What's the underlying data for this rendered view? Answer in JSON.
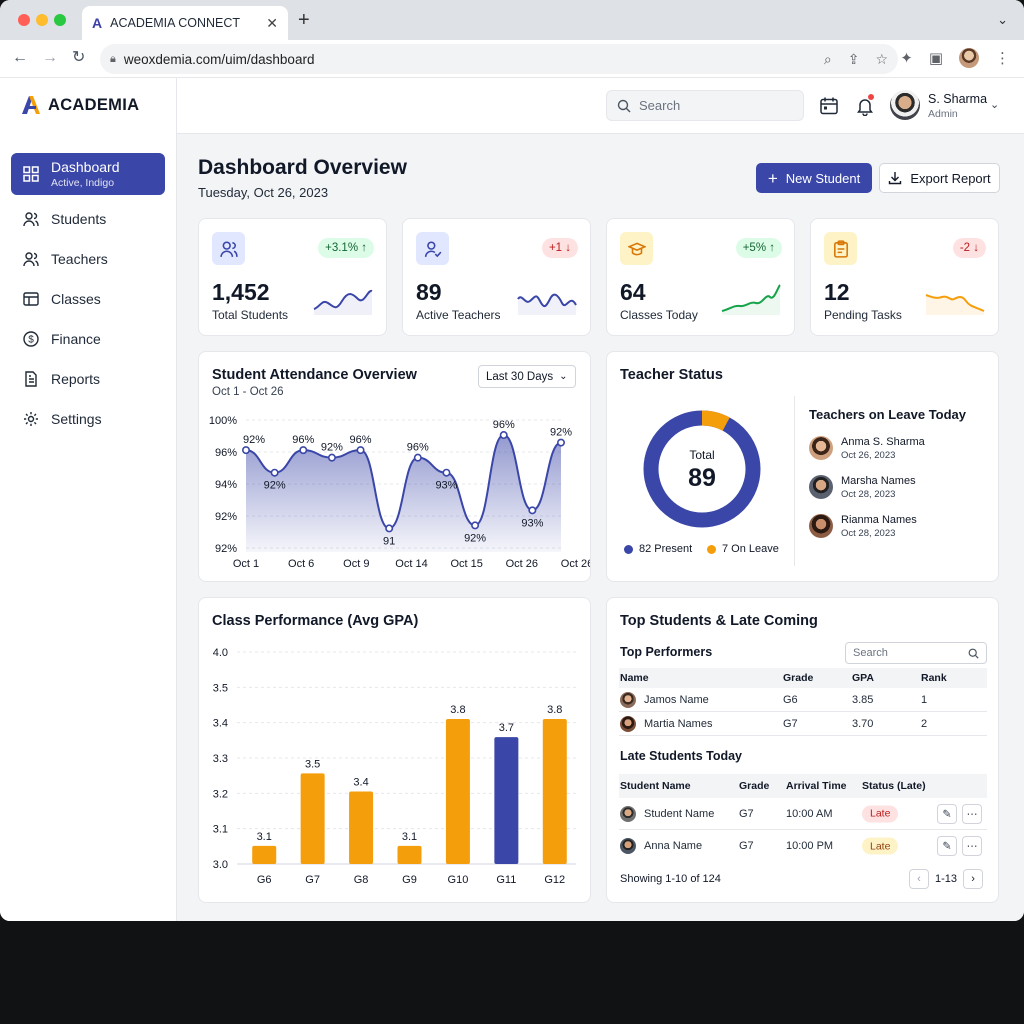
{
  "browser": {
    "tab_title": "ACADEMIA CONNECT",
    "tab_favicon": "A",
    "url": "weoxdemia.com/uim/dashboard",
    "new_tab_symbol": "+",
    "close_symbol": "✕"
  },
  "sidebar": {
    "brand": "ACADEMIA",
    "items": [
      {
        "label": "Dashboard",
        "sub": "Active, Indigo",
        "icon": "grid-icon"
      },
      {
        "label": "Students",
        "icon": "users-icon"
      },
      {
        "label": "Teachers",
        "icon": "user-group-icon"
      },
      {
        "label": "Classes",
        "icon": "classes-icon"
      },
      {
        "label": "Finance",
        "icon": "dollar-icon"
      },
      {
        "label": "Reports",
        "icon": "report-icon"
      },
      {
        "label": "Settings",
        "icon": "gear-icon"
      }
    ]
  },
  "header": {
    "search_placeholder": "Search",
    "user_name": "S. Sharma",
    "user_role": "Admin"
  },
  "page": {
    "title": "Dashboard Overview",
    "date": "Tuesday, Oct 26, 2023",
    "new_student_label": "New Student",
    "export_label": "Export Report"
  },
  "stats": [
    {
      "value": "1,452",
      "label": "Total Students",
      "badge": "+3.1% ↑",
      "trend": "up",
      "icon": "users-icon",
      "icon_bg": "#e0e7ff",
      "spark_color": "#3a46a8"
    },
    {
      "value": "89",
      "label": "Active Teachers",
      "badge": "+1 ↓",
      "trend": "down",
      "icon": "user-check-icon",
      "icon_bg": "#e0e7ff",
      "spark_color": "#3a46a8"
    },
    {
      "value": "64",
      "label": "Classes Today",
      "badge": "+5% ↑",
      "trend": "up",
      "icon": "graduation-cap-icon",
      "icon_bg": "#fef3c7",
      "spark_color": "#16a34a"
    },
    {
      "value": "12",
      "label": "Pending Tasks",
      "badge": "-2 ↓",
      "trend": "down",
      "icon": "clipboard-icon",
      "icon_bg": "#fef3c7",
      "spark_color": "#f59e0b"
    }
  ],
  "attendance": {
    "title": "Student Attendance Overview",
    "subtitle": "Oct 1 - Oct 26",
    "range_label": "Last 30 Days"
  },
  "teacher_status": {
    "title": "Teacher Status",
    "total_label": "Total",
    "total_value": "89",
    "present_label": "82 Present",
    "leave_label": "7 On Leave",
    "present": 82,
    "on_leave": 7,
    "present_color": "#3a46a8",
    "leave_color": "#f59e0b",
    "leave_title": "Teachers on Leave Today",
    "leave_list": [
      {
        "name": "Anma S. Sharma",
        "date": "Oct 26, 2023"
      },
      {
        "name": "Marsha Names",
        "date": "Oct 28, 2023"
      },
      {
        "name": "Rianma Names",
        "date": "Oct 28, 2023"
      }
    ]
  },
  "performance": {
    "title": "Class Performance (Avg GPA)"
  },
  "top_students": {
    "title": "Top Students & Late Coming",
    "performers_title": "Top Performers",
    "search_placeholder": "Search",
    "performer_headers": [
      "Name",
      "Grade",
      "GPA",
      "Rank"
    ],
    "performers": [
      {
        "name": "Jamos Name",
        "grade": "G6",
        "gpa": "3.85",
        "rank": "1"
      },
      {
        "name": "Martia Names",
        "grade": "G7",
        "gpa": "3.70",
        "rank": "2"
      }
    ],
    "late_title": "Late Students Today",
    "late_headers": [
      "Student Name",
      "Grade",
      "Arrival Time",
      "Status (Late)"
    ],
    "late": [
      {
        "name": "Student Name",
        "grade": "G7",
        "time": "10:00 AM",
        "status": "Late",
        "pill_bg": "#fee2e2",
        "pill_fg": "#b91c1c"
      },
      {
        "name": "Anna Name",
        "grade": "G7",
        "time": "10:00 PM",
        "status": "Late",
        "pill_bg": "#fef3c7",
        "pill_fg": "#92400e"
      }
    ],
    "showing": "Showing 1-10 of 124",
    "page_range": "1-13"
  },
  "chart_data": [
    {
      "type": "area",
      "title": "Student Attendance Overview",
      "categories": [
        "Oct 1",
        "Oct 6",
        "Oct 9",
        "Oct 14",
        "Oct 15",
        "Oct 26",
        "Oct 26"
      ],
      "y_ticks": [
        "100%",
        "96%",
        "94%",
        "92%",
        "92%"
      ],
      "values": [
        98,
        96.5,
        98,
        97.5,
        98,
        92.8,
        97.5,
        96.5,
        93,
        99,
        94,
        98.5
      ],
      "labels": [
        "92%",
        "92%",
        "96%",
        "92%",
        "96%",
        "91",
        "96%",
        "93%",
        "92%",
        "96%",
        "93%",
        "92%"
      ],
      "color": "#3a46a8"
    },
    {
      "type": "bar",
      "title": "Class Performance (Avg GPA)",
      "categories": [
        "G6",
        "G7",
        "G8",
        "G9",
        "G10",
        "G11",
        "G12"
      ],
      "values": [
        3.1,
        3.5,
        3.4,
        3.1,
        3.8,
        3.7,
        3.8
      ],
      "labels": [
        "3.1",
        "3.5",
        "3.4",
        "3.1",
        "3.8",
        "3.7",
        "3.8"
      ],
      "y_ticks": [
        "4.0",
        "3.5",
        "3.4",
        "3.3",
        "3.2",
        "3.1",
        "3.0"
      ],
      "colors": [
        "#f59e0b",
        "#f59e0b",
        "#f59e0b",
        "#f59e0b",
        "#f59e0b",
        "#3a46a8",
        "#f59e0b"
      ]
    }
  ]
}
